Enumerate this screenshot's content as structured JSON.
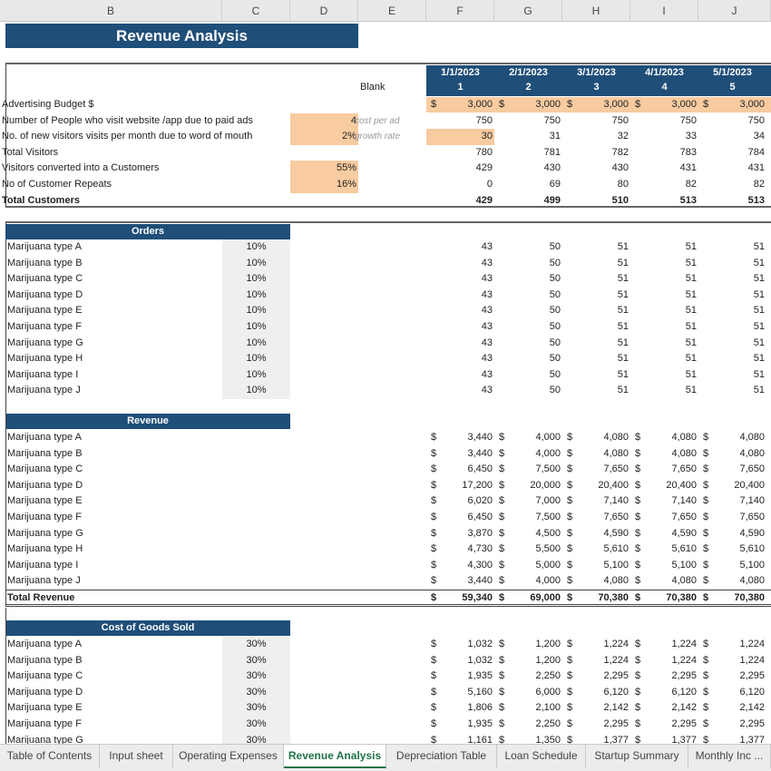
{
  "columns": [
    "B",
    "C",
    "D",
    "E",
    "F",
    "G",
    "H",
    "I",
    "J"
  ],
  "title": "Revenue Analysis",
  "blank_label": "Blank",
  "months": [
    {
      "date": "1/1/2023",
      "num": "1"
    },
    {
      "date": "2/1/2023",
      "num": "2"
    },
    {
      "date": "3/1/2023",
      "num": "3"
    },
    {
      "date": "4/1/2023",
      "num": "4"
    },
    {
      "date": "5/1/2023",
      "num": "5"
    }
  ],
  "assumptions": {
    "rows": [
      {
        "label": "Advertising Budget $",
        "input": "",
        "note": "",
        "values": [
          "3,000",
          "3,000",
          "3,000",
          "3,000",
          "3,000"
        ],
        "dollar": true,
        "bold": false
      },
      {
        "label": "Number of People who visit website /app due to paid ads",
        "input": "4",
        "note": "cost per ad",
        "values": [
          "750",
          "750",
          "750",
          "750",
          "750"
        ],
        "dollar": false,
        "bold": false
      },
      {
        "label": "No. of new visitors visits per month due to word of mouth",
        "input": "2%",
        "note": "growth rate",
        "values": [
          "30",
          "31",
          "32",
          "33",
          "34"
        ],
        "dollar": false,
        "bold": false
      },
      {
        "label": "Total Visitors",
        "input": "",
        "note": "",
        "values": [
          "780",
          "781",
          "782",
          "783",
          "784"
        ],
        "dollar": false,
        "bold": false
      },
      {
        "label": "Visitors converted into a Customers",
        "input": "55%",
        "note": "",
        "values": [
          "429",
          "430",
          "430",
          "431",
          "431"
        ],
        "dollar": false,
        "bold": false
      },
      {
        "label": "No of Customer Repeats",
        "input": "16%",
        "note": "",
        "values": [
          "0",
          "69",
          "80",
          "82",
          "82"
        ],
        "dollar": false,
        "bold": false
      },
      {
        "label": "Total Customers",
        "input": "",
        "note": "",
        "values": [
          "429",
          "499",
          "510",
          "513",
          "513"
        ],
        "dollar": false,
        "bold": true
      }
    ]
  },
  "orders": {
    "header": "Orders",
    "rows": [
      {
        "label": "Marijuana type A",
        "pct": "10%",
        "values": [
          "43",
          "50",
          "51",
          "51",
          "51"
        ]
      },
      {
        "label": "Marijuana type B",
        "pct": "10%",
        "values": [
          "43",
          "50",
          "51",
          "51",
          "51"
        ]
      },
      {
        "label": "Marijuana type C",
        "pct": "10%",
        "values": [
          "43",
          "50",
          "51",
          "51",
          "51"
        ]
      },
      {
        "label": "Marijuana type D",
        "pct": "10%",
        "values": [
          "43",
          "50",
          "51",
          "51",
          "51"
        ]
      },
      {
        "label": "Marijuana type E",
        "pct": "10%",
        "values": [
          "43",
          "50",
          "51",
          "51",
          "51"
        ]
      },
      {
        "label": "Marijuana type F",
        "pct": "10%",
        "values": [
          "43",
          "50",
          "51",
          "51",
          "51"
        ]
      },
      {
        "label": "Marijuana type G",
        "pct": "10%",
        "values": [
          "43",
          "50",
          "51",
          "51",
          "51"
        ]
      },
      {
        "label": "Marijuana type H",
        "pct": "10%",
        "values": [
          "43",
          "50",
          "51",
          "51",
          "51"
        ]
      },
      {
        "label": "Marijuana type I",
        "pct": "10%",
        "values": [
          "43",
          "50",
          "51",
          "51",
          "51"
        ]
      },
      {
        "label": "Marijuana type J",
        "pct": "10%",
        "values": [
          "43",
          "50",
          "51",
          "51",
          "51"
        ]
      }
    ]
  },
  "revenue": {
    "header": "Revenue",
    "rows": [
      {
        "label": "Marijuana type A",
        "values": [
          "3,440",
          "4,000",
          "4,080",
          "4,080",
          "4,080"
        ]
      },
      {
        "label": "Marijuana type B",
        "values": [
          "3,440",
          "4,000",
          "4,080",
          "4,080",
          "4,080"
        ]
      },
      {
        "label": "Marijuana type C",
        "values": [
          "6,450",
          "7,500",
          "7,650",
          "7,650",
          "7,650"
        ]
      },
      {
        "label": "Marijuana type D",
        "values": [
          "17,200",
          "20,000",
          "20,400",
          "20,400",
          "20,400"
        ]
      },
      {
        "label": "Marijuana type E",
        "values": [
          "6,020",
          "7,000",
          "7,140",
          "7,140",
          "7,140"
        ]
      },
      {
        "label": "Marijuana type F",
        "values": [
          "6,450",
          "7,500",
          "7,650",
          "7,650",
          "7,650"
        ]
      },
      {
        "label": "Marijuana type G",
        "values": [
          "3,870",
          "4,500",
          "4,590",
          "4,590",
          "4,590"
        ]
      },
      {
        "label": "Marijuana type H",
        "values": [
          "4,730",
          "5,500",
          "5,610",
          "5,610",
          "5,610"
        ]
      },
      {
        "label": "Marijuana type I",
        "values": [
          "4,300",
          "5,000",
          "5,100",
          "5,100",
          "5,100"
        ]
      },
      {
        "label": "Marijuana type J",
        "values": [
          "3,440",
          "4,000",
          "4,080",
          "4,080",
          "4,080"
        ]
      }
    ],
    "total_label": "Total Revenue",
    "total_values": [
      "59,340",
      "69,000",
      "70,380",
      "70,380",
      "70,380"
    ]
  },
  "cogs": {
    "header": "Cost of Goods Sold",
    "rows": [
      {
        "label": "Marijuana type A",
        "pct": "30%",
        "values": [
          "1,032",
          "1,200",
          "1,224",
          "1,224",
          "1,224"
        ]
      },
      {
        "label": "Marijuana type B",
        "pct": "30%",
        "values": [
          "1,032",
          "1,200",
          "1,224",
          "1,224",
          "1,224"
        ]
      },
      {
        "label": "Marijuana type C",
        "pct": "30%",
        "values": [
          "1,935",
          "2,250",
          "2,295",
          "2,295",
          "2,295"
        ]
      },
      {
        "label": "Marijuana type D",
        "pct": "30%",
        "values": [
          "5,160",
          "6,000",
          "6,120",
          "6,120",
          "6,120"
        ]
      },
      {
        "label": "Marijuana type E",
        "pct": "30%",
        "values": [
          "1,806",
          "2,100",
          "2,142",
          "2,142",
          "2,142"
        ]
      },
      {
        "label": "Marijuana type F",
        "pct": "30%",
        "values": [
          "1,935",
          "2,250",
          "2,295",
          "2,295",
          "2,295"
        ]
      },
      {
        "label": "Marijuana type G",
        "pct": "30%",
        "values": [
          "1,161",
          "1,350",
          "1,377",
          "1,377",
          "1,377"
        ]
      }
    ]
  },
  "currency_symbol": "$",
  "tabs": [
    {
      "label": "Table of Contents",
      "active": false
    },
    {
      "label": "Input sheet",
      "active": false
    },
    {
      "label": "Operating Expenses",
      "active": false
    },
    {
      "label": "Revenue Analysis",
      "active": true
    },
    {
      "label": "Depreciation Table",
      "active": false
    },
    {
      "label": "Loan Schedule",
      "active": false
    },
    {
      "label": "Startup Summary",
      "active": false
    },
    {
      "label": "Monthly Inc ...",
      "active": false
    }
  ],
  "colors": {
    "header_blue": "#1f4e79",
    "input_orange": "#f8cba0",
    "active_tab_green": "#217346"
  }
}
